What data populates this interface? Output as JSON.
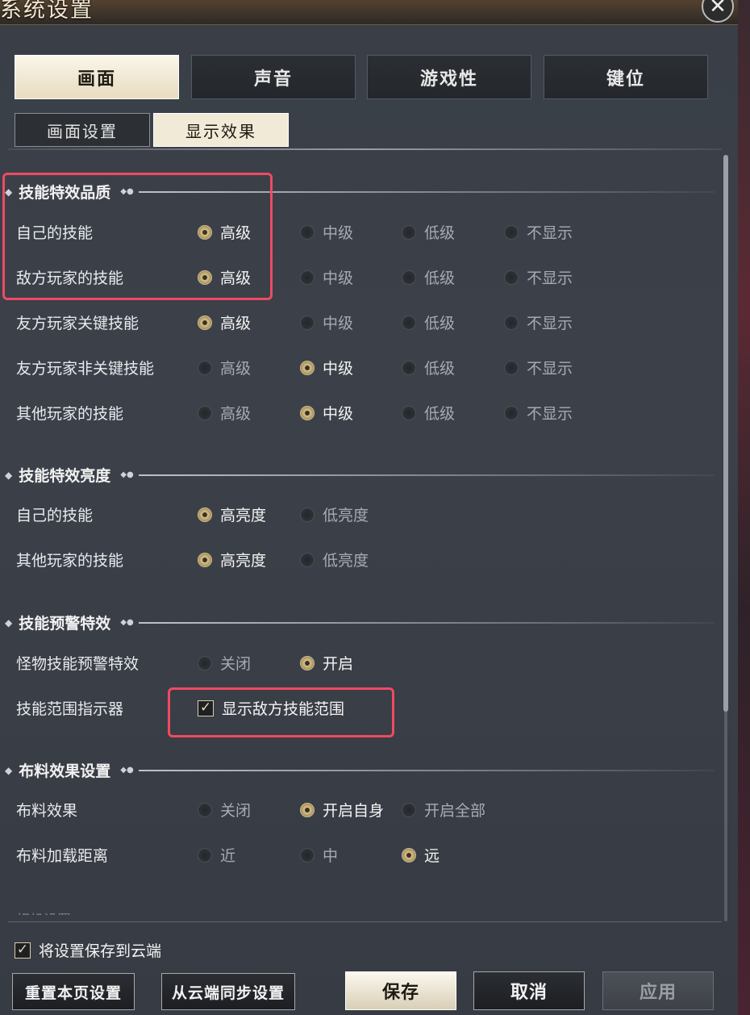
{
  "window": {
    "title": "系统设置"
  },
  "main_tabs": [
    {
      "label": "画面",
      "active": true
    },
    {
      "label": "声音",
      "active": false
    },
    {
      "label": "游戏性",
      "active": false
    },
    {
      "label": "键位",
      "active": false
    }
  ],
  "sub_tabs": [
    {
      "label": "画面设置",
      "active": false
    },
    {
      "label": "显示效果",
      "active": true
    }
  ],
  "sections": {
    "skill_quality": {
      "title": "技能特效品质",
      "options": [
        "高级",
        "中级",
        "低级",
        "不显示"
      ],
      "rows": [
        {
          "label": "自己的技能",
          "selected": "高级"
        },
        {
          "label": "敌方玩家的技能",
          "selected": "高级"
        },
        {
          "label": "友方玩家关键技能",
          "selected": "高级"
        },
        {
          "label": "友方玩家非关键技能",
          "selected": "中级"
        },
        {
          "label": "其他玩家的技能",
          "selected": "中级"
        }
      ]
    },
    "skill_brightness": {
      "title": "技能特效亮度",
      "options": [
        "高亮度",
        "低亮度"
      ],
      "rows": [
        {
          "label": "自己的技能",
          "selected": "高亮度"
        },
        {
          "label": "其他玩家的技能",
          "selected": "高亮度"
        }
      ]
    },
    "skill_warning": {
      "title": "技能预警特效",
      "monster_warning": {
        "label": "怪物技能预警特效",
        "options": [
          "关闭",
          "开启"
        ],
        "selected": "开启"
      },
      "range_indicator": {
        "label": "技能范围指示器",
        "checkbox_label": "显示敌方技能范围",
        "checked": true
      }
    },
    "cloth": {
      "title": "布料效果设置",
      "effect": {
        "label": "布料效果",
        "options": [
          "关闭",
          "开启自身",
          "开启全部"
        ],
        "selected": "开启自身"
      },
      "distance": {
        "label": "布料加载距离",
        "options": [
          "近",
          "中",
          "远"
        ],
        "selected": "远"
      }
    },
    "next_section_partial": "相机设置"
  },
  "footer": {
    "save_to_cloud": {
      "label": "将设置保存到云端",
      "checked": true
    },
    "buttons": {
      "reset": "重置本页设置",
      "sync": "从云端同步设置",
      "save": "保存",
      "cancel": "取消",
      "apply": "应用"
    }
  },
  "colors": {
    "highlight": "#ef4a63",
    "radio_checked": "#bca36a",
    "active_tab": "#f1ead7"
  }
}
